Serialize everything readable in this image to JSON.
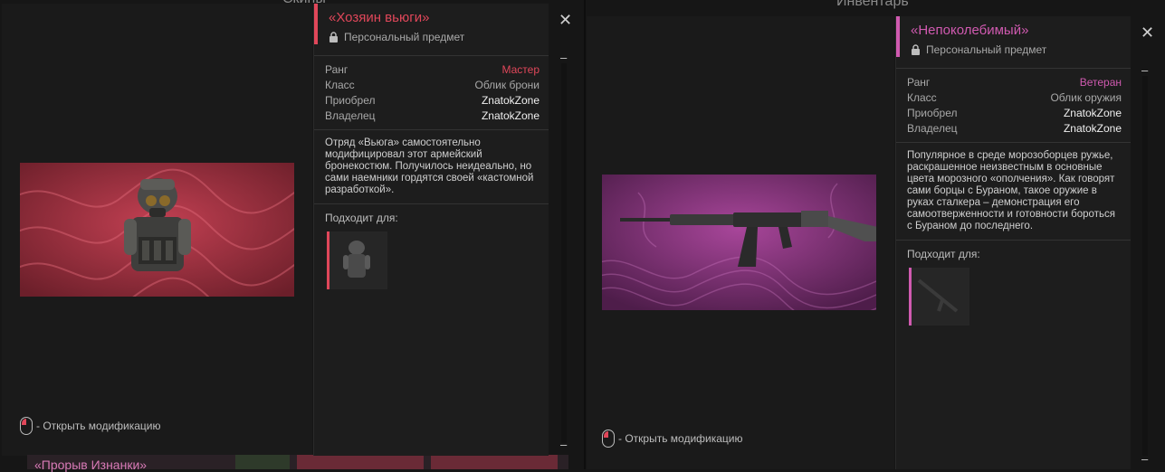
{
  "left_window": {
    "header_cut": "Скины",
    "hint": "- Открыть модификацию",
    "below_cut_title": "«Прорыв Изнанки»",
    "card": {
      "title": "«Хозяин вьюги»",
      "accent": "#e0475a",
      "subtitle": "Персональный предмет",
      "rows": [
        {
          "key": "Ранг",
          "value": "Мастер",
          "value_color": "#e0475a"
        },
        {
          "key": "Класс",
          "value": "Облик брони",
          "value_color": "#a8a8a8"
        },
        {
          "key": "Приобрел",
          "value": "ZnatokZone",
          "value_color": "#f0f0f0"
        },
        {
          "key": "Владелец",
          "value": "ZnatokZone",
          "value_color": "#f0f0f0"
        }
      ],
      "description": "Отряд «Вьюга» самостоятельно модифицировал этот армейский бронекостюм. Получилось неидеально, но сами наемники гордятся своей «кастомной разработкой».",
      "fits_label": "Подходит для:"
    }
  },
  "right_window": {
    "header_cut": "Инвентарь",
    "hint": "- Открыть модификацию",
    "card": {
      "title": "«Непоколебимый»",
      "accent": "#d05ab0",
      "subtitle": "Персональный предмет",
      "rows": [
        {
          "key": "Ранг",
          "value": "Ветеран",
          "value_color": "#d05ab0"
        },
        {
          "key": "Класс",
          "value": "Облик оружия",
          "value_color": "#a8a8a8"
        },
        {
          "key": "Приобрел",
          "value": "ZnatokZone",
          "value_color": "#f0f0f0"
        },
        {
          "key": "Владелец",
          "value": "ZnatokZone",
          "value_color": "#f0f0f0"
        }
      ],
      "description": "Популярное в среде морозоборцев ружье, раскрашенное неизвестным в основные цвета морозного «ополчения». Как говорят сами борцы с Бураном, такое оружие в руках сталкера – демонстрация его самоотверженности и готовности бороться с Бураном до последнего.",
      "fits_label": "Подходит для:"
    }
  },
  "icons": {
    "close": "✕",
    "minus": "–"
  }
}
